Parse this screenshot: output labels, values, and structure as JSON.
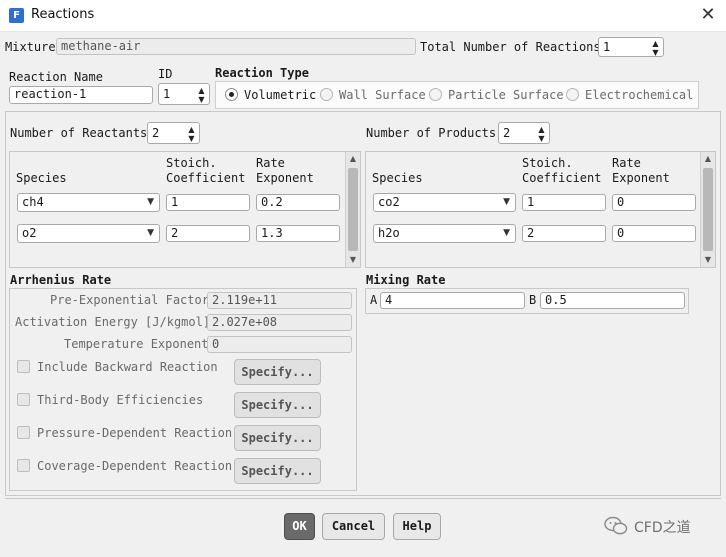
{
  "window": {
    "title": "Reactions",
    "app_icon_letter": "F",
    "close_label": "✕"
  },
  "mixture": {
    "label": "Mixture",
    "value": "methane-air"
  },
  "total_reactions": {
    "label": "Total Number of Reactions",
    "value": "1"
  },
  "reaction_name": {
    "label": "Reaction Name",
    "value": "reaction-1"
  },
  "reaction_id": {
    "label": "ID",
    "value": "1"
  },
  "reaction_type": {
    "label": "Reaction Type",
    "options": [
      {
        "label": "Volumetric",
        "selected": true
      },
      {
        "label": "Wall Surface",
        "selected": false
      },
      {
        "label": "Particle Surface",
        "selected": false
      },
      {
        "label": "Electrochemical",
        "selected": false
      }
    ]
  },
  "reactants": {
    "count_label": "Number of Reactants",
    "count": "2",
    "headers": {
      "species": "Species",
      "stoich_1": "Stoich.",
      "stoich_2": "Coefficient",
      "rate_1": "Rate",
      "rate_2": "Exponent"
    },
    "rows": [
      {
        "species": "ch4",
        "coefficient": "1",
        "exponent": "0.2"
      },
      {
        "species": "o2",
        "coefficient": "2",
        "exponent": "1.3"
      }
    ]
  },
  "products": {
    "count_label": "Number of Products",
    "count": "2",
    "headers": {
      "species": "Species",
      "stoich_1": "Stoich.",
      "stoich_2": "Coefficient",
      "rate_1": "Rate",
      "rate_2": "Exponent"
    },
    "rows": [
      {
        "species": "co2",
        "coefficient": "1",
        "exponent": "0"
      },
      {
        "species": "h2o",
        "coefficient": "2",
        "exponent": "0"
      }
    ]
  },
  "arrhenius": {
    "title": "Arrhenius Rate",
    "pre_exp_label": "Pre-Exponential Factor",
    "pre_exp_value": "2.119e+11",
    "activation_label": "Activation Energy [J/kgmol]",
    "activation_value": "2.027e+08",
    "temp_exp_label": "Temperature Exponent",
    "temp_exp_value": "0",
    "options": [
      {
        "label": "Include Backward Reaction",
        "button": "Specify..."
      },
      {
        "label": "Third-Body Efficiencies",
        "button": "Specify..."
      },
      {
        "label": "Pressure-Dependent Reaction",
        "button": "Specify..."
      },
      {
        "label": "Coverage-Dependent Reaction",
        "button": "Specify..."
      }
    ]
  },
  "mixing": {
    "title": "Mixing Rate",
    "a_label": "A",
    "a_value": "4",
    "b_label": "B",
    "b_value": "0.5"
  },
  "buttons": {
    "ok": "OK",
    "cancel": "Cancel",
    "help": "Help"
  },
  "watermark": {
    "text": "CFD之道"
  },
  "colors": {
    "dialog_bg": "#f0f0f0",
    "ok_bg": "#6a6a6a",
    "app_icon": "#2f6fd1"
  }
}
